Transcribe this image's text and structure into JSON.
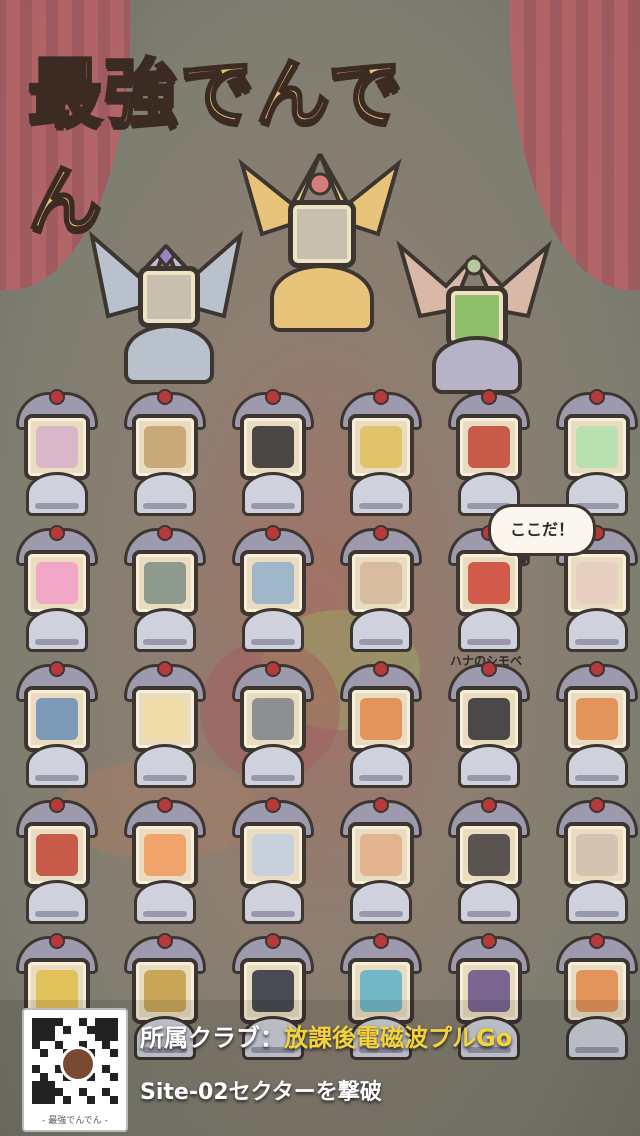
{
  "game": {
    "logo_text": "最強でんでん"
  },
  "colors": {
    "gold": "#e8c37a",
    "silver": "#b9c2cc",
    "bronze": "#d9b8a8",
    "frame": "#3d3530",
    "curtain": "#a8353c",
    "club_name": "#f4d23a"
  },
  "top_trophies": [
    {
      "rank": "gold",
      "icon": "robot-character-icon"
    },
    {
      "rank": "silver",
      "icon": "mech-character-icon"
    },
    {
      "rank": "bronze",
      "icon": "green-frog-character-icon"
    }
  ],
  "grid": {
    "rows": [
      [
        {
          "icon": "blonde-girl-portrait-icon",
          "color": "#d9b7c9"
        },
        {
          "icon": "masked-man-portrait-icon",
          "color": "#c9a978"
        },
        {
          "icon": "dark-monster-portrait-icon",
          "color": "#4a4644"
        },
        {
          "icon": "yellow-snail-icon",
          "color": "#e0c36a"
        },
        {
          "icon": "red-hair-girl-portrait-icon",
          "color": "#c85a4a"
        },
        {
          "icon": "green-blob-portrait-icon",
          "color": "#b7dfb0"
        }
      ],
      [
        {
          "icon": "pink-eyeball-creature-icon",
          "color": "#f2a7c8"
        },
        {
          "icon": "machine-parts-icon",
          "color": "#8e9a8e"
        },
        {
          "icon": "jet-plane-icon",
          "color": "#9fb7c9"
        },
        {
          "icon": "snail-icon",
          "color": "#d8bca0"
        },
        {
          "icon": "red-hooded-creature-icon",
          "color": "#d15a4a"
        },
        {
          "icon": "dark-hair-girl-portrait-icon",
          "color": "#e7cfc1"
        }
      ],
      [
        {
          "icon": "blue-dragon-icon",
          "color": "#7c9ab8"
        },
        {
          "icon": "blonde-boy-portrait-icon",
          "color": "#f0dca6"
        },
        {
          "icon": "gray-robot-portrait-icon",
          "color": "#8e8f92"
        },
        {
          "icon": "orange-fish-icon",
          "color": "#e3945a"
        },
        {
          "icon": "dark-cat-portrait-icon",
          "color": "#4a4848"
        },
        {
          "icon": "orange-fish-icon",
          "color": "#e3945a"
        }
      ],
      [
        {
          "icon": "red-cyclops-icon",
          "color": "#c85a4a"
        },
        {
          "icon": "orange-hair-girl-portrait-icon",
          "color": "#f0a36a"
        },
        {
          "icon": "white-orb-robot-icon",
          "color": "#c8d0dc"
        },
        {
          "icon": "sunglasses-man-portrait-icon",
          "color": "#e2b38e"
        },
        {
          "icon": "dark-robot-icon",
          "color": "#5a5450"
        },
        {
          "icon": "old-man-portrait-icon",
          "color": "#d3c3b0"
        }
      ],
      [
        {
          "icon": "yellow-bird-icon",
          "color": "#e0c15a"
        },
        {
          "icon": "golden-mech-icon",
          "color": "#c9a658"
        },
        {
          "icon": "shadow-creature-icon",
          "color": "#4a4a52"
        },
        {
          "icon": "teal-orb-icon",
          "color": "#72b7c6"
        },
        {
          "icon": "purple-hair-portrait-icon",
          "color": "#7a6690"
        },
        {
          "icon": "orange-fish-icon",
          "color": "#e3945a"
        }
      ]
    ],
    "highlight": {
      "row": 1,
      "col": 4,
      "name": "ハナのシモベ",
      "bubble_text": "ここだ！"
    }
  },
  "footer": {
    "qr_caption": "- 最強でんでん -",
    "club_label": "所属クラブ：",
    "club_name": "放課後電磁波プルGo",
    "mission": "Site-02セクターを撃破"
  }
}
